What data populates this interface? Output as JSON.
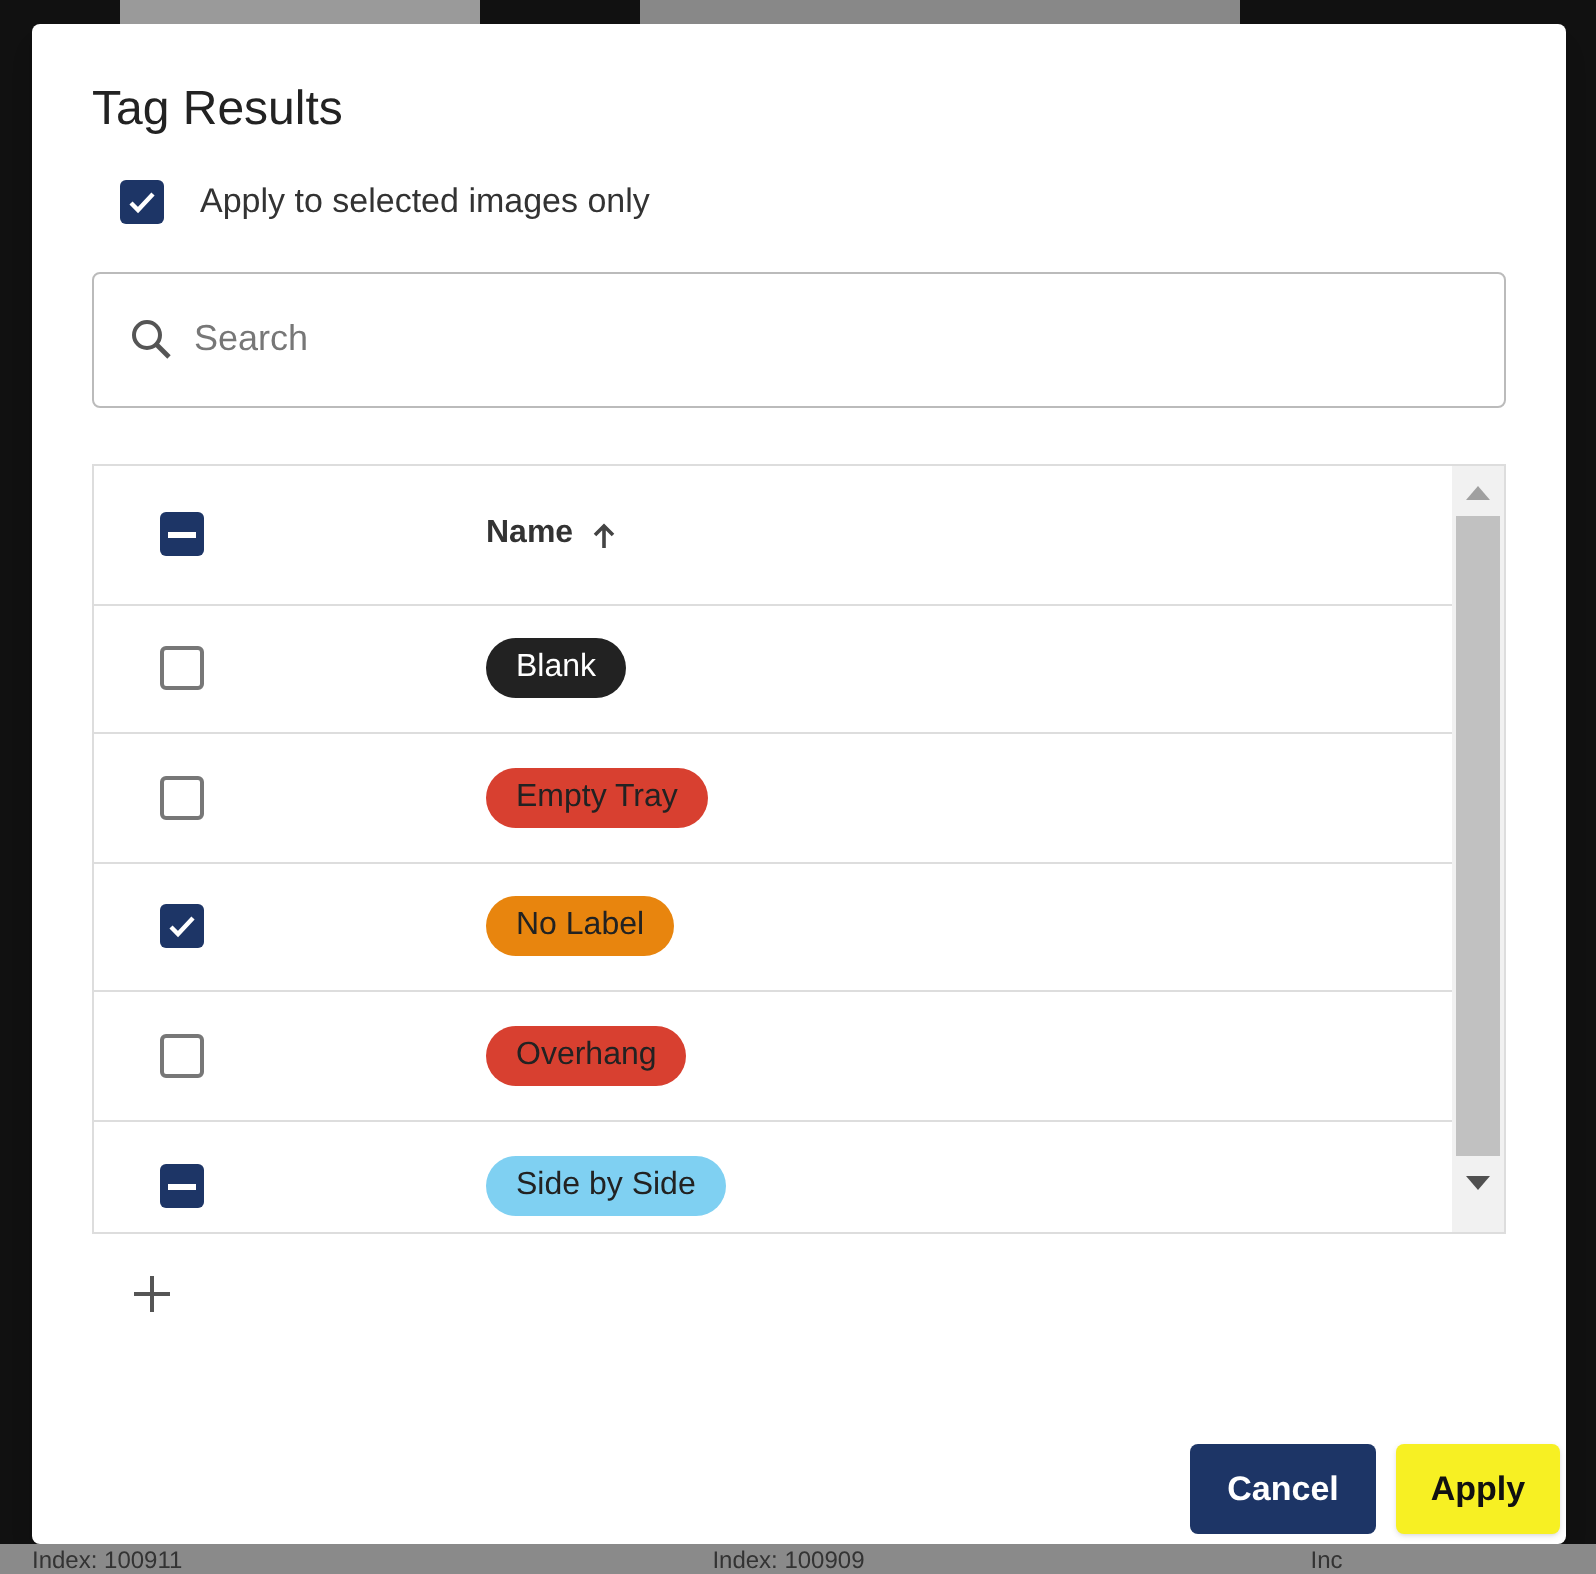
{
  "dialog": {
    "title": "Tag Results",
    "apply_selected": {
      "label": "Apply to selected images only",
      "checked": true
    },
    "search": {
      "placeholder": "Search"
    },
    "table": {
      "header": {
        "checked": true,
        "indeterminate": true,
        "column": "Name",
        "sort_ascending": true
      },
      "rows": [
        {
          "tag": "Blank",
          "color": "#222222",
          "checked": false,
          "indeterminate": false
        },
        {
          "tag": "Empty Tray",
          "color": "#d84030",
          "checked": false,
          "indeterminate": false
        },
        {
          "tag": "No Label",
          "color": "#e8850e",
          "checked": true,
          "indeterminate": false
        },
        {
          "tag": "Overhang",
          "color": "#d84030",
          "checked": false,
          "indeterminate": false
        },
        {
          "tag": "Side by Side",
          "color": "#7fd0f2",
          "checked": true,
          "indeterminate": true
        }
      ]
    },
    "buttons": [
      {
        "label": "Cancel",
        "kind": "secondary"
      },
      {
        "label": "Apply",
        "kind": "primary"
      }
    ]
  },
  "background": {
    "labels": [
      "Index: 100911",
      "Index: 100909",
      "Inc"
    ]
  }
}
